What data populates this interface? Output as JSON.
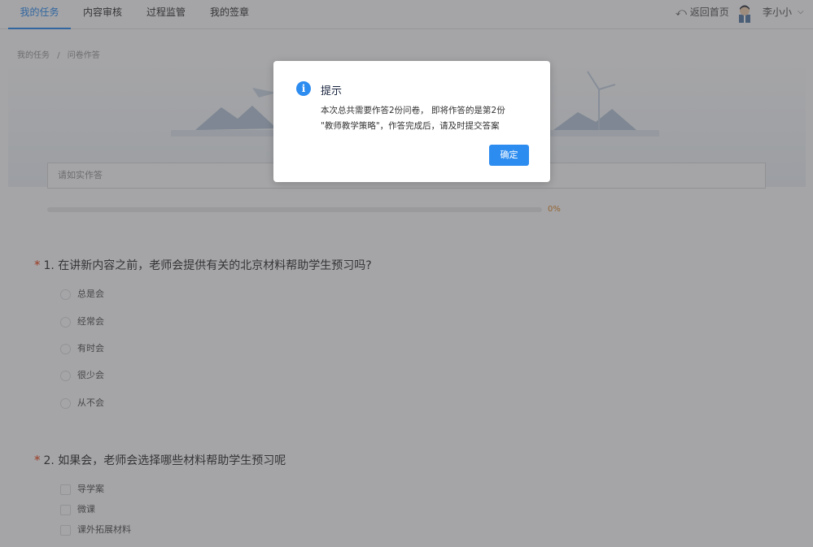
{
  "nav": {
    "tabs": [
      {
        "label": "我的任务"
      },
      {
        "label": "内容审核"
      },
      {
        "label": "过程监管"
      },
      {
        "label": "我的签章"
      }
    ],
    "back_label": "返回首页",
    "username": "李小小",
    "accent": "#2d8cf0"
  },
  "breadcrumb": [
    "我的任务",
    "/",
    "问卷作答"
  ],
  "intro": {
    "placeholder": "请如实作答"
  },
  "progress": {
    "percent": 0,
    "label": "0%"
  },
  "questions": [
    {
      "number_title": "1. 在讲新内容之前，老师会提供有关的北京材料帮助学生预习吗?",
      "type": "radio",
      "options": [
        "总是会",
        "经常会",
        "有时会",
        "很少会",
        "从不会"
      ]
    },
    {
      "number_title": "2. 如果会，老师会选择哪些材料帮助学生预习呢",
      "type": "checkbox",
      "options": [
        "导学案",
        "微课",
        "课外拓展材料"
      ]
    }
  ],
  "modal": {
    "icon": "info-icon",
    "title": "提示",
    "line1": "本次总共需要作答2份问卷， 即将作答的是第2份",
    "line2": "\"教师教学策略\"，作答完成后，请及时提交答案",
    "confirm_label": "确定"
  }
}
